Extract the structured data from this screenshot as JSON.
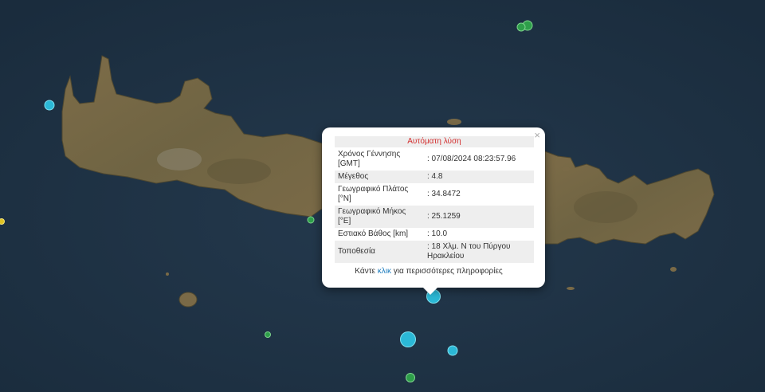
{
  "map": {
    "colors": {
      "sea": "#1f3346",
      "land": "#7a6a47",
      "land_dark": "#5c5336",
      "marker_cyan": "#2bb8d6",
      "marker_green": "#2e9e4a",
      "marker_yellow": "#e0c323"
    },
    "markers": [
      {
        "name": "earthquake-marker-selected",
        "color": "cyan",
        "magnitude_class": "large"
      },
      {
        "name": "earthquake-marker",
        "color": "cyan",
        "magnitude_class": "large"
      },
      {
        "name": "earthquake-marker",
        "color": "cyan",
        "magnitude_class": "medium"
      },
      {
        "name": "earthquake-marker",
        "color": "cyan",
        "magnitude_class": "medium"
      },
      {
        "name": "earthquake-marker",
        "color": "green",
        "magnitude_class": "medium"
      },
      {
        "name": "earthquake-marker",
        "color": "green",
        "magnitude_class": "medium"
      },
      {
        "name": "earthquake-marker",
        "color": "green",
        "magnitude_class": "small"
      },
      {
        "name": "earthquake-marker",
        "color": "green",
        "magnitude_class": "small"
      },
      {
        "name": "earthquake-marker",
        "color": "yellow",
        "magnitude_class": "small"
      }
    ]
  },
  "popup": {
    "close_icon": "×",
    "title": "Αυτόματη λύση",
    "rows": [
      {
        "label": "Χρόνος Γέννησης [GMT]",
        "value": ": 07/08/2024 08:23:57.96"
      },
      {
        "label": "Μέγεθος",
        "value": ": 4.8"
      },
      {
        "label": "Γεωγραφικό Πλάτος [°N]",
        "value": ": 34.8472"
      },
      {
        "label": "Γεωγραφικό Μήκος [°E]",
        "value": ": 25.1259"
      },
      {
        "label": "Εστιακό Βάθος [km]",
        "value": ": 10.0"
      },
      {
        "label": "Τοποθεσία",
        "value": ": 18 Χλμ. Ν του Πύργου Ηρακλείου"
      }
    ],
    "more_prefix": "Κάντε ",
    "more_link": "κλικ",
    "more_suffix": " για περισσότερες πληροφορίες"
  }
}
